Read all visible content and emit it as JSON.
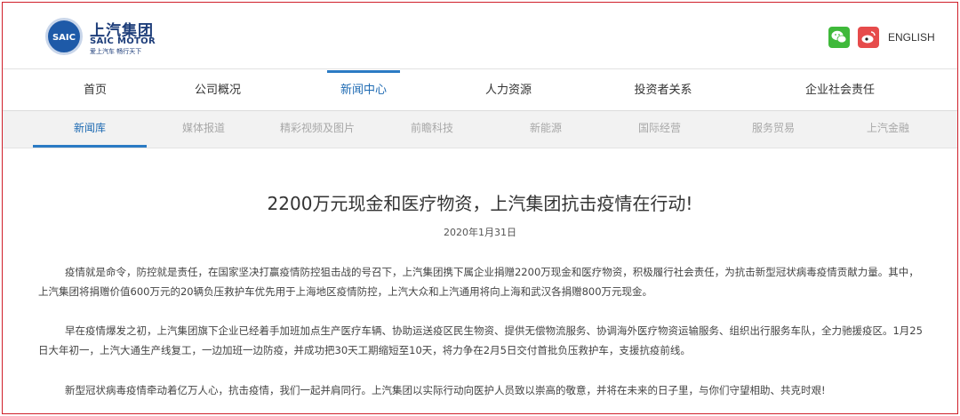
{
  "brand": {
    "logo_mark": "SAIC",
    "name_cn": "上汽集团",
    "name_en": "SAIC MOTOR",
    "slogan": "爱上汽车 畅行天下"
  },
  "header": {
    "wechat_icon": "wechat-icon",
    "weibo_icon": "weibo-icon",
    "language_link": "ENGLISH"
  },
  "main_nav": {
    "items": [
      {
        "label": "首页"
      },
      {
        "label": "公司概况"
      },
      {
        "label": "新闻中心",
        "active": true
      },
      {
        "label": "人力资源"
      },
      {
        "label": "投资者关系"
      },
      {
        "label": "企业社会责任"
      }
    ]
  },
  "sub_nav": {
    "items": [
      {
        "label": "新闻库",
        "active": true
      },
      {
        "label": "媒体报道"
      },
      {
        "label": "精彩视频及图片"
      },
      {
        "label": "前瞻科技"
      },
      {
        "label": "新能源"
      },
      {
        "label": "国际经营"
      },
      {
        "label": "服务贸易"
      },
      {
        "label": "上汽金融"
      }
    ]
  },
  "article": {
    "title": "2200万元现金和医疗物资，上汽集团抗击疫情在行动!",
    "date": "2020年1月31日",
    "paragraphs": [
      "疫情就是命令，防控就是责任，在国家坚决打赢疫情防控狙击战的号召下，上汽集团携下属企业捐赠2200万现金和医疗物资，积极履行社会责任，为抗击新型冠状病毒疫情贡献力量。其中，上汽集团将捐赠价值600万元的20辆负压救护车优先用于上海地区疫情防控，上汽大众和上汽通用将向上海和武汉各捐赠800万元现金。",
      "早在疫情爆发之初，上汽集团旗下企业已经着手加班加点生产医疗车辆、协助运送疫区民生物资、提供无偿物流服务、协调海外医疗物资运输服务、组织出行服务车队，全力驰援疫区。1月25日大年初一，上汽大通生产线复工，一边加班一边防疫，并成功把30天工期缩短至10天，将力争在2月5日交付首批负压救护车，支援抗疫前线。",
      "新型冠状病毒疫情牵动着亿万人心，抗击疫情，我们一起并肩同行。上汽集团以实际行动向医护人员致以崇高的敬意，并将在未来的日子里，与你们守望相助、共克时艰!"
    ]
  },
  "colors": {
    "brand_blue": "#1e3e7a",
    "accent_blue": "#2b7bc4",
    "frame_red": "#d01f2a",
    "wechat_green": "#3fb93a",
    "weibo_red": "#e64b4b"
  }
}
